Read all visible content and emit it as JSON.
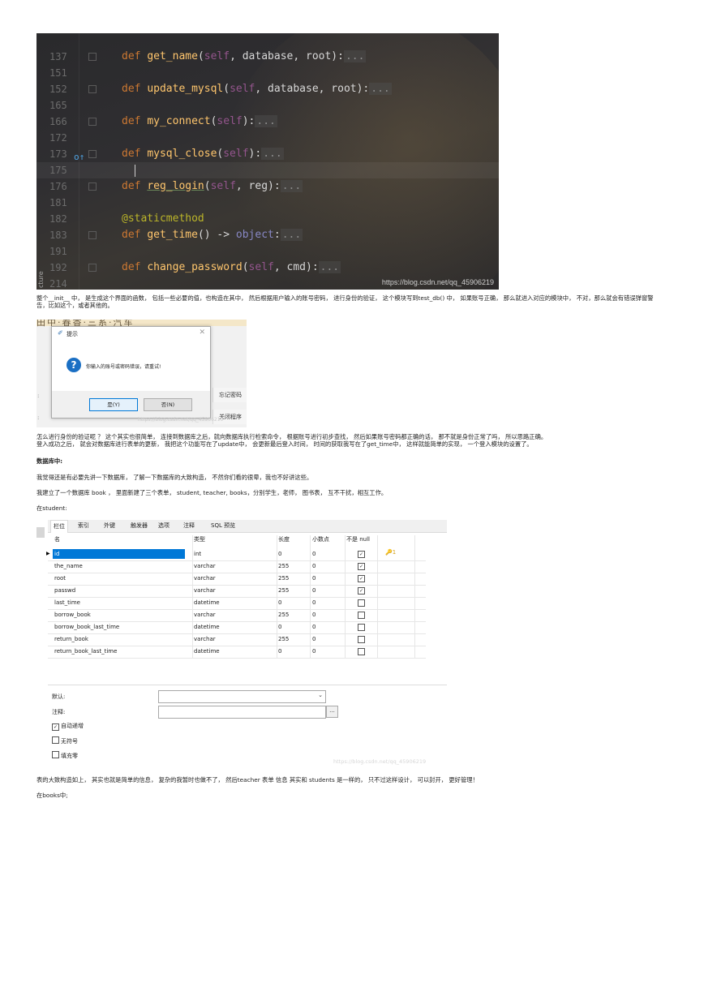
{
  "code": {
    "lines": [
      {
        "num": "137",
        "prefix": "def ",
        "name": "get_name",
        "args": "(self, database, root):"
      },
      {
        "num": "151"
      },
      {
        "num": "152",
        "prefix": "def ",
        "name": "update_mysql",
        "args": "(self, database, root):"
      },
      {
        "num": "165"
      },
      {
        "num": "166",
        "prefix": "def ",
        "name": "my_connect",
        "args": "(self):"
      },
      {
        "num": "172"
      },
      {
        "num": "173",
        "prefix": "def ",
        "name": "mysql_close",
        "args": "(self):"
      },
      {
        "num": "175"
      },
      {
        "num": "176",
        "prefix": "def ",
        "name": "reg_login",
        "args": "(self, reg):"
      },
      {
        "num": "181"
      },
      {
        "num": "182",
        "decorator": "@staticmethod"
      },
      {
        "num": "183",
        "prefix": "def ",
        "name": "get_time",
        "args": "() -> ",
        "ret": "object",
        "tail": ":"
      },
      {
        "num": "191"
      },
      {
        "num": "192",
        "prefix": "def ",
        "name": "change_password",
        "args": "(self, cmd):"
      },
      {
        "num": "214"
      }
    ],
    "dots": "...",
    "watermark": "https://blog.csdn.net/qq_45906219",
    "sidebar_tab": "cture"
  },
  "para1": "整个__init__ 中， 是生成这个界面的函数， 包括一些必要的值，也构造在其中， 然后根据用户输入的账号密码， 进行身份的验证， 这个模块写到test_db() 中， 如果账号正确， 那么就进入对应的模块中， 不对，那么就会有错误弹窗警告，比如这个，或者其他的。",
  "dialog_shot": {
    "top_text": "田中·春香·三系·汽车",
    "title": "提示",
    "message": "你输入的账号或密码错误，请重试!",
    "yes": "是(Y)",
    "no": "否(N)",
    "side_forgot": "忘记密码",
    "side_close": "关闭程序",
    "left_marks": [
      ":",
      ":"
    ],
    "watermark": "https://blog.csdn.net/qq_45906219"
  },
  "para2": "怎么进行身份的验证呢 ？ 这个其实也很简单， 连接到数据库之后，就向数据库执行检索命令， 根据账号进行初步查找， 然后如果账号密码都正确的话， 那不就是身份正常了吗， 所以思路正确。",
  "para3": "登入成功之后， 就会对数据库进行表单的更新， 我把这个功能写在了update中， 会更新最后登入时间， 时间的获取我写在了get_time中， 这样就能简单的实现， 一个登入模块的设置了。",
  "heading_db": "数据库中:",
  "para4": "我觉得还是有必要先讲一下数据库， 了解一下数据库的大致构造， 不然你们看的很晕，我也不好讲这些。",
  "para5": "我建立了一个数据库 book ， 里面新建了三个表单， student, teacher, books，分别学生，老师， 图书表， 互不干扰，相互工作。",
  "para6": "在student:",
  "table_design": {
    "tabs": [
      "栏位",
      "索引",
      "外键",
      "触发器",
      "选项",
      "注释",
      "SQL 预览"
    ],
    "headers": {
      "name": "名",
      "type": "类型",
      "length": "长度",
      "decimals": "小数点",
      "notnull": "不是 null"
    },
    "rows": [
      {
        "name": "id",
        "type": "int",
        "length": "0",
        "decimals": "0",
        "notnull": true,
        "key": "1"
      },
      {
        "name": "the_name",
        "type": "varchar",
        "length": "255",
        "decimals": "0",
        "notnull": true
      },
      {
        "name": "root",
        "type": "varchar",
        "length": "255",
        "decimals": "0",
        "notnull": true
      },
      {
        "name": "passwd",
        "type": "varchar",
        "length": "255",
        "decimals": "0",
        "notnull": true
      },
      {
        "name": "last_time",
        "type": "datetime",
        "length": "0",
        "decimals": "0",
        "notnull": false
      },
      {
        "name": "borrow_book",
        "type": "varchar",
        "length": "255",
        "decimals": "0",
        "notnull": false
      },
      {
        "name": "borrow_book_last_time",
        "type": "datetime",
        "length": "0",
        "decimals": "0",
        "notnull": false
      },
      {
        "name": "return_book",
        "type": "varchar",
        "length": "255",
        "decimals": "0",
        "notnull": false
      },
      {
        "name": "return_book_last_time",
        "type": "datetime",
        "length": "0",
        "decimals": "0",
        "notnull": false
      }
    ],
    "default_label": "默认:",
    "comment_label": "注释:",
    "ellipsis": "...",
    "options": [
      {
        "label": "自动递增",
        "checked": true
      },
      {
        "label": "无符号",
        "checked": false
      },
      {
        "label": "填充零",
        "checked": false
      }
    ],
    "watermark": "https://blog.csdn.net/qq_45906219"
  },
  "para7": "表的大致构造如上， 其实也就是简单的信息， 复杂的我暂时也做不了， 然后teacher 表单 信息 其实和 students 是一样的， 只不过这样设计， 可以封开， 更好管理！",
  "para8": "在books中;"
}
